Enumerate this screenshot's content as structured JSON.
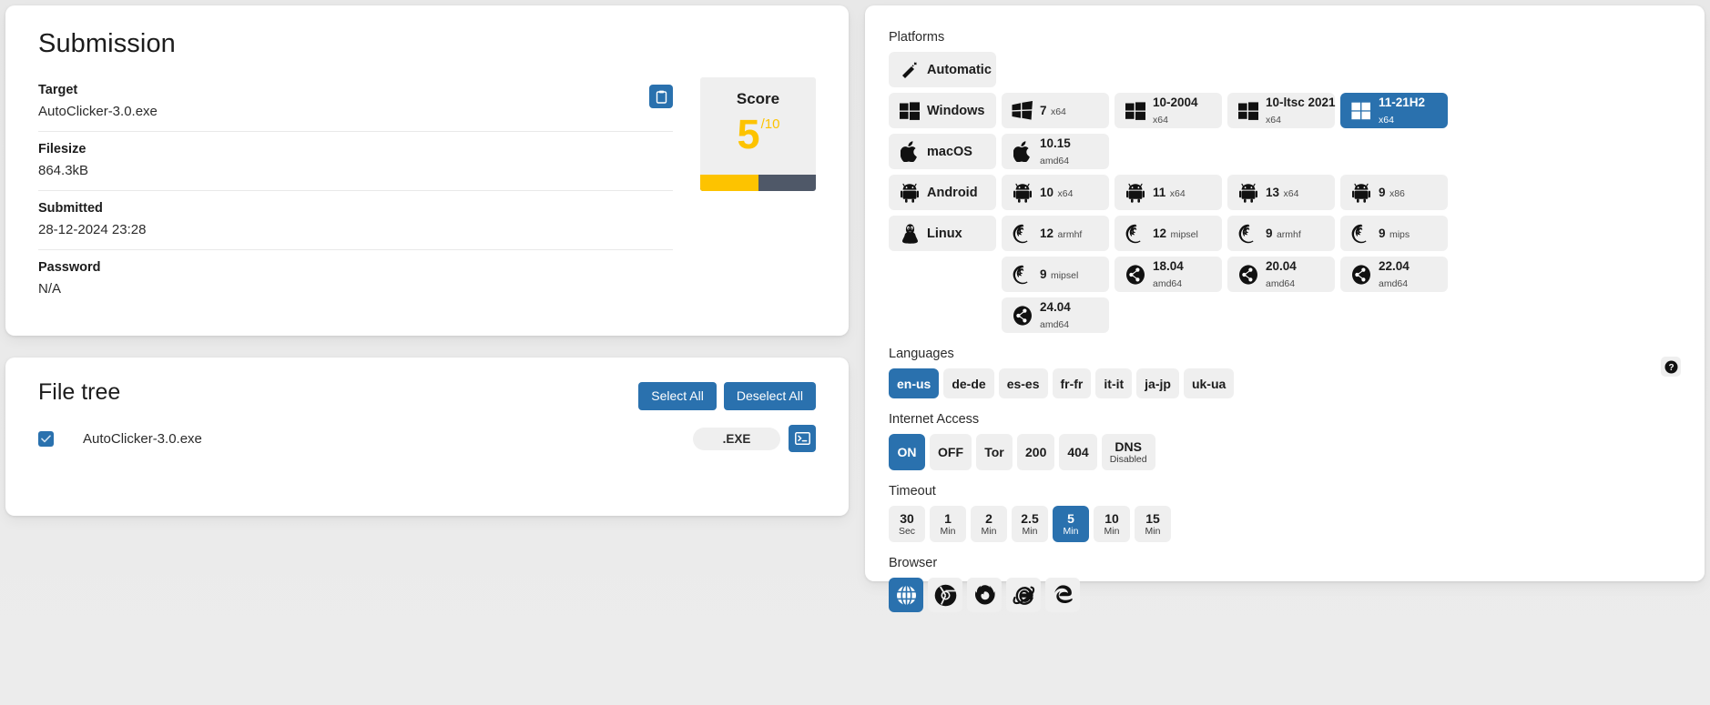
{
  "submission": {
    "title": "Submission",
    "fields": [
      {
        "label": "Target",
        "value": "AutoClicker-3.0.exe"
      },
      {
        "label": "Filesize",
        "value": "864.3kB"
      },
      {
        "label": "Submitted",
        "value": "28-12-2024 23:28"
      },
      {
        "label": "Password",
        "value": "N/A"
      }
    ],
    "copy_icon": "clipboard-icon",
    "score": {
      "label": "Score",
      "value": "5",
      "max": "/10",
      "percent": 50,
      "fill_color": "#fdc300",
      "track_color": "#4f5868"
    }
  },
  "filetree": {
    "title": "File tree",
    "select_all": "Select All",
    "deselect_all": "Deselect All",
    "rows": [
      {
        "name": "AutoClicker-3.0.exe",
        "extension": ".EXE",
        "checked": true
      }
    ]
  },
  "platforms": {
    "label": "Platforms",
    "automatic": {
      "label": "Automatic",
      "icon": "magic-wand-icon"
    },
    "rows": [
      {
        "os": "Windows",
        "os_icon": "windows-icon",
        "versions": [
          {
            "name": "7",
            "arch": "x64",
            "icon": "windows-classic-icon",
            "selected": false
          },
          {
            "name": "10-2004",
            "arch": "x64",
            "icon": "windows-icon",
            "selected": false
          },
          {
            "name": "10-ltsc 2021",
            "arch": "x64",
            "icon": "windows-icon",
            "selected": false
          },
          {
            "name": "11-21H2",
            "arch": "x64",
            "icon": "windows11-icon",
            "selected": true
          }
        ]
      },
      {
        "os": "macOS",
        "os_icon": "apple-icon",
        "versions": [
          {
            "name": "10.15",
            "arch": "amd64",
            "icon": "apple-icon",
            "selected": false
          }
        ]
      },
      {
        "os": "Android",
        "os_icon": "android-icon",
        "versions": [
          {
            "name": "10",
            "arch": "x64",
            "icon": "android-icon",
            "selected": false
          },
          {
            "name": "11",
            "arch": "x64",
            "icon": "android-icon",
            "selected": false
          },
          {
            "name": "13",
            "arch": "x64",
            "icon": "android-icon",
            "selected": false
          },
          {
            "name": "9",
            "arch": "x86",
            "icon": "android-icon",
            "selected": false
          }
        ]
      },
      {
        "os": "Linux",
        "os_icon": "linux-tux-icon",
        "versions": [
          {
            "name": "12",
            "arch": "armhf",
            "icon": "debian-icon",
            "selected": false
          },
          {
            "name": "12",
            "arch": "mipsel",
            "icon": "debian-icon",
            "selected": false
          },
          {
            "name": "9",
            "arch": "armhf",
            "icon": "debian-icon",
            "selected": false
          },
          {
            "name": "9",
            "arch": "mips",
            "icon": "debian-icon",
            "selected": false
          }
        ]
      },
      {
        "os": "",
        "os_icon": "",
        "versions": [
          {
            "name": "9",
            "arch": "mipsel",
            "icon": "debian-icon",
            "selected": false
          },
          {
            "name": "18.04",
            "arch": "amd64",
            "icon": "ubuntu-icon",
            "selected": false
          },
          {
            "name": "20.04",
            "arch": "amd64",
            "icon": "ubuntu-icon",
            "selected": false
          },
          {
            "name": "22.04",
            "arch": "amd64",
            "icon": "ubuntu-icon",
            "selected": false
          }
        ]
      },
      {
        "os": "",
        "os_icon": "",
        "versions": [
          {
            "name": "24.04",
            "arch": "amd64",
            "icon": "ubuntu-icon",
            "selected": false
          }
        ]
      }
    ]
  },
  "languages": {
    "label": "Languages",
    "options": [
      {
        "label": "en-us",
        "selected": true
      },
      {
        "label": "de-de",
        "selected": false
      },
      {
        "label": "es-es",
        "selected": false
      },
      {
        "label": "fr-fr",
        "selected": false
      },
      {
        "label": "it-it",
        "selected": false
      },
      {
        "label": "ja-jp",
        "selected": false
      },
      {
        "label": "uk-ua",
        "selected": false
      }
    ]
  },
  "internet_access": {
    "label": "Internet Access",
    "options": [
      {
        "main": "ON",
        "sub": "",
        "selected": true
      },
      {
        "main": "OFF",
        "sub": "",
        "selected": false
      },
      {
        "main": "Tor",
        "sub": "",
        "selected": false
      },
      {
        "main": "200",
        "sub": "",
        "selected": false
      },
      {
        "main": "404",
        "sub": "",
        "selected": false
      },
      {
        "main": "DNS",
        "sub": "Disabled",
        "selected": false
      }
    ]
  },
  "timeout": {
    "label": "Timeout",
    "options": [
      {
        "main": "30",
        "sub": "Sec",
        "selected": false
      },
      {
        "main": "1",
        "sub": "Min",
        "selected": false
      },
      {
        "main": "2",
        "sub": "Min",
        "selected": false
      },
      {
        "main": "2.5",
        "sub": "Min",
        "selected": false
      },
      {
        "main": "5",
        "sub": "Min",
        "selected": true
      },
      {
        "main": "10",
        "sub": "Min",
        "selected": false
      },
      {
        "main": "15",
        "sub": "Min",
        "selected": false
      }
    ]
  },
  "browser": {
    "label": "Browser",
    "options": [
      {
        "icon": "globe-icon",
        "selected": true
      },
      {
        "icon": "chrome-icon",
        "selected": false
      },
      {
        "icon": "firefox-icon",
        "selected": false
      },
      {
        "icon": "internet-explorer-icon",
        "selected": false
      },
      {
        "icon": "edge-icon",
        "selected": false
      }
    ]
  },
  "help": {
    "icon": "help-circle-icon"
  },
  "theme": {
    "accent": "#2a71ae",
    "tile_bg": "#efefef",
    "score_yellow": "#fdc300"
  }
}
